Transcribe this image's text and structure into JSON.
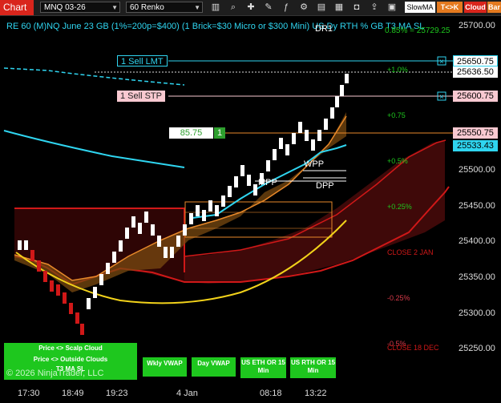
{
  "toolbar": {
    "chart_tab": "Chart",
    "instrument": "MNQ 03-26",
    "bar_type": "60 Renko",
    "indicator": "SlowMA",
    "tk_label": "T<>K",
    "cloud_label": "Cloud",
    "bar_label": "Bar"
  },
  "title": "RE 60 (M)NQ June 23 GB (1%=200p=$400) (1 Brick=$30 Micro or $300 Mini) US Dy RTH % GB  T3 MA SL",
  "title_overlay": "DR1",
  "title_overlay2": "0.85% = 25729.25",
  "price_axis": {
    "ticks": [
      "25700.00",
      "25650.75",
      "25636.50",
      "25600.75",
      "25550.75",
      "25533.43",
      "25500.00",
      "25450.00",
      "25400.00",
      "25350.00",
      "25300.00",
      "25250.00"
    ],
    "tags": {
      "sell_lmt_price": "25650.75",
      "last_price": "25636.50",
      "sell_stp_price": "25600.75",
      "entry_price": "25550.75",
      "ma_price": "25533.43"
    }
  },
  "orders": {
    "sell_lmt": "1 Sell LMT",
    "sell_stp": "1 Sell STP",
    "entry_value": "85.75",
    "entry_qty": "1"
  },
  "levels": {
    "plus_1": "+1.0%",
    "plus_075": "+0.75",
    "plus_05": "+0.5%",
    "plus_025": "+0.25%",
    "minus_025": "-0.25%",
    "minus_05": "-0.5%",
    "close_2jan": "CLOSE 2 JAN",
    "close_18dec": "CLOSE 18 DEC",
    "wpp": "WPP",
    "mpp": "MPP",
    "dpp": "DPP"
  },
  "time_axis": [
    "17:30",
    "18:49",
    "19:23",
    "4 Jan",
    "08:18",
    "13:22"
  ],
  "buttons": {
    "scalp": "Price <> Scalp Cloud",
    "outside": "Price <> Outside Clouds",
    "t3": "T3 MA SL",
    "wkly_vwap": "Wkly VWAP",
    "day_vwap": "Day VWAP",
    "us_eth": "US ETH OR 15 Min",
    "us_rth": "US RTH OR 15 Min"
  },
  "copyright": "© 2026 NinjaTrader, LLC",
  "colors": {
    "accent": "#d9251c",
    "cyan": "#2fd5f0",
    "green": "#1ec71e",
    "order_pink": "#f9c9d1",
    "entry_green": "#2e9f2e"
  }
}
